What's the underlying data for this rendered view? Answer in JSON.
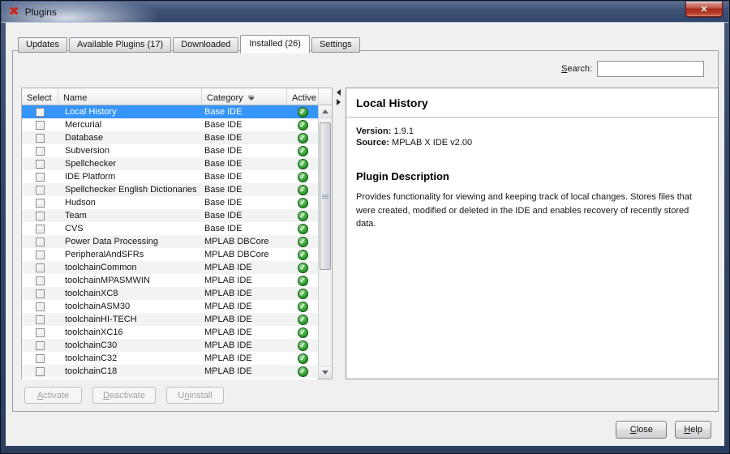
{
  "window": {
    "title": "Plugins"
  },
  "icons": {
    "app": "✖",
    "close": "✕",
    "check": "✓"
  },
  "tabs": [
    {
      "label": "Updates",
      "selected": false
    },
    {
      "label": "Available Plugins (17)",
      "selected": false
    },
    {
      "label": "Downloaded",
      "selected": false
    },
    {
      "label": "Installed (26)",
      "selected": true
    },
    {
      "label": "Settings",
      "selected": false
    }
  ],
  "search": {
    "label": {
      "pre": "",
      "key": "S",
      "post": "earch:"
    },
    "value": ""
  },
  "table": {
    "columns": [
      "Select",
      "Name",
      "Category",
      "Active"
    ],
    "rows": [
      {
        "name": "Local History",
        "category": "Base IDE",
        "active": true,
        "checked": false,
        "selected": true
      },
      {
        "name": "Mercurial",
        "category": "Base IDE",
        "active": true,
        "checked": false
      },
      {
        "name": "Database",
        "category": "Base IDE",
        "active": true,
        "checked": false
      },
      {
        "name": "Subversion",
        "category": "Base IDE",
        "active": true,
        "checked": false
      },
      {
        "name": "Spellchecker",
        "category": "Base IDE",
        "active": true,
        "checked": false
      },
      {
        "name": "IDE Platform",
        "category": "Base IDE",
        "active": true,
        "checked": false
      },
      {
        "name": "Spellchecker English Dictionaries",
        "category": "Base IDE",
        "active": true,
        "checked": false
      },
      {
        "name": "Hudson",
        "category": "Base IDE",
        "active": true,
        "checked": false
      },
      {
        "name": "Team",
        "category": "Base IDE",
        "active": true,
        "checked": false
      },
      {
        "name": "CVS",
        "category": "Base IDE",
        "active": true,
        "checked": false
      },
      {
        "name": "Power Data Processing",
        "category": "MPLAB DBCore",
        "active": true,
        "checked": false
      },
      {
        "name": "PeripheralAndSFRs",
        "category": "MPLAB DBCore",
        "active": true,
        "checked": false
      },
      {
        "name": "toolchainCommon",
        "category": "MPLAB IDE",
        "active": true,
        "checked": false
      },
      {
        "name": "toolchainMPASMWIN",
        "category": "MPLAB IDE",
        "active": true,
        "checked": false
      },
      {
        "name": "toolchainXC8",
        "category": "MPLAB IDE",
        "active": true,
        "checked": false
      },
      {
        "name": "toolchainASM30",
        "category": "MPLAB IDE",
        "active": true,
        "checked": false
      },
      {
        "name": "toolchainHI-TECH",
        "category": "MPLAB IDE",
        "active": true,
        "checked": false
      },
      {
        "name": "toolchainXC16",
        "category": "MPLAB IDE",
        "active": true,
        "checked": false
      },
      {
        "name": "toolchainC30",
        "category": "MPLAB IDE",
        "active": true,
        "checked": false
      },
      {
        "name": "toolchainC32",
        "category": "MPLAB IDE",
        "active": true,
        "checked": false
      },
      {
        "name": "toolchainC18",
        "category": "MPLAB IDE",
        "active": true,
        "checked": false
      }
    ],
    "partial_row_visible": true
  },
  "details": {
    "title": "Local History",
    "version_label": "Version:",
    "version": "1.9.1",
    "source_label": "Source:",
    "source": "MPLAB X IDE v2.00",
    "description_title": "Plugin Description",
    "description": "Provides functionality for viewing and keeping track of local changes. Stores files that were created, modified or deleted in the IDE and enables recovery of recently stored data."
  },
  "actions": [
    {
      "pre": "",
      "key": "A",
      "post": "ctivate",
      "enabled": false
    },
    {
      "pre": "",
      "key": "D",
      "post": "eactivate",
      "enabled": false
    },
    {
      "pre": "U",
      "key": "n",
      "post": "install",
      "enabled": false
    }
  ],
  "footer": {
    "close": {
      "pre": "",
      "key": "C",
      "post": "lose"
    },
    "help": {
      "pre": "",
      "key": "H",
      "post": "elp"
    }
  },
  "colors": {
    "selection": "#3695f8",
    "active_green": "#2e9d36",
    "titlebar": "#36496c",
    "close_button_red": "#b0331f"
  }
}
